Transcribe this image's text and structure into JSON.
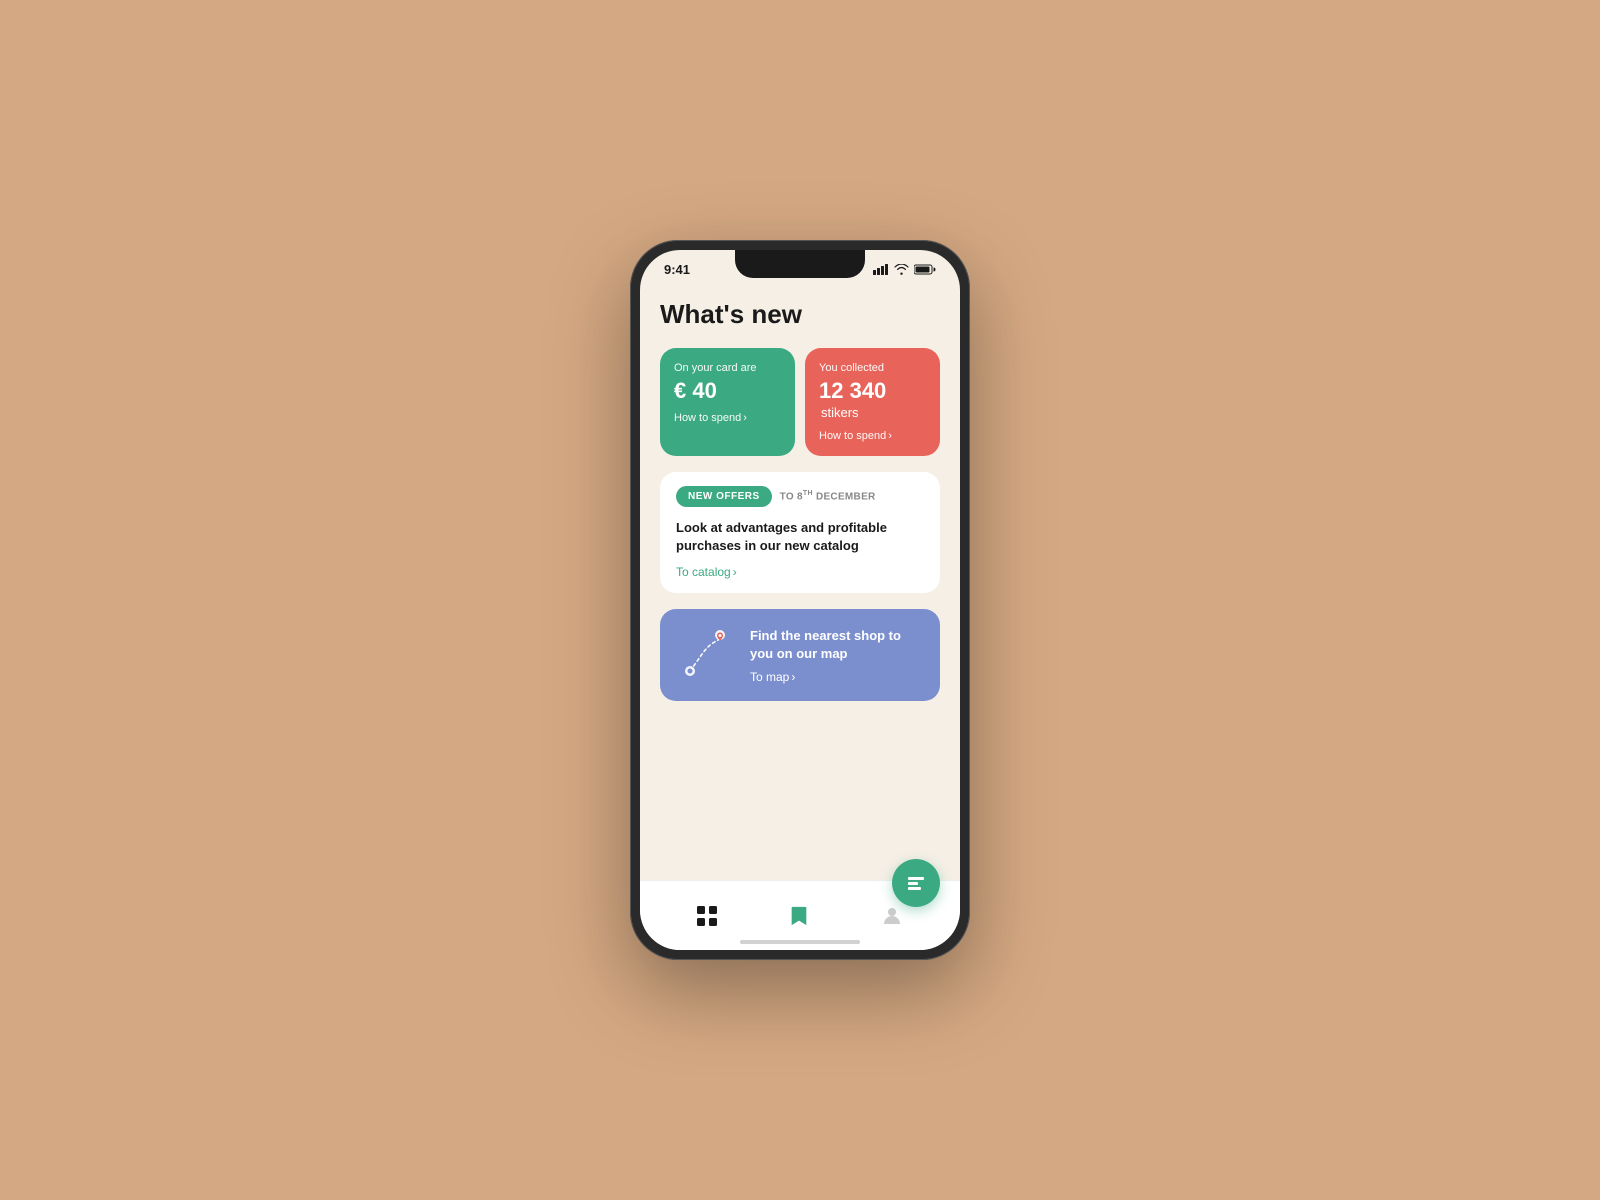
{
  "page": {
    "title": "What's new"
  },
  "status_bar": {
    "time": "9:41"
  },
  "card_green": {
    "label": "On your card are",
    "currency": "€",
    "amount": "40",
    "link": "How to spend"
  },
  "card_red": {
    "label": "You collected",
    "amount": "12 340",
    "unit": "stikers",
    "link": "How to spend"
  },
  "offers_card": {
    "tag_new": "NEW OFFERS",
    "tag_date": "TO 8TH DECEMBER",
    "title": "Look at advantages and profitable purchases in our new catalog",
    "link": "To catalog"
  },
  "map_card": {
    "title": "Find the nearest shop to you on our map",
    "link": "To map"
  },
  "nav": {
    "items": [
      "grid",
      "bookmark",
      "profile"
    ]
  },
  "colors": {
    "green": "#3BAA82",
    "red": "#E8645A",
    "blue": "#7B8FCF",
    "bg": "#F5EFE6"
  }
}
